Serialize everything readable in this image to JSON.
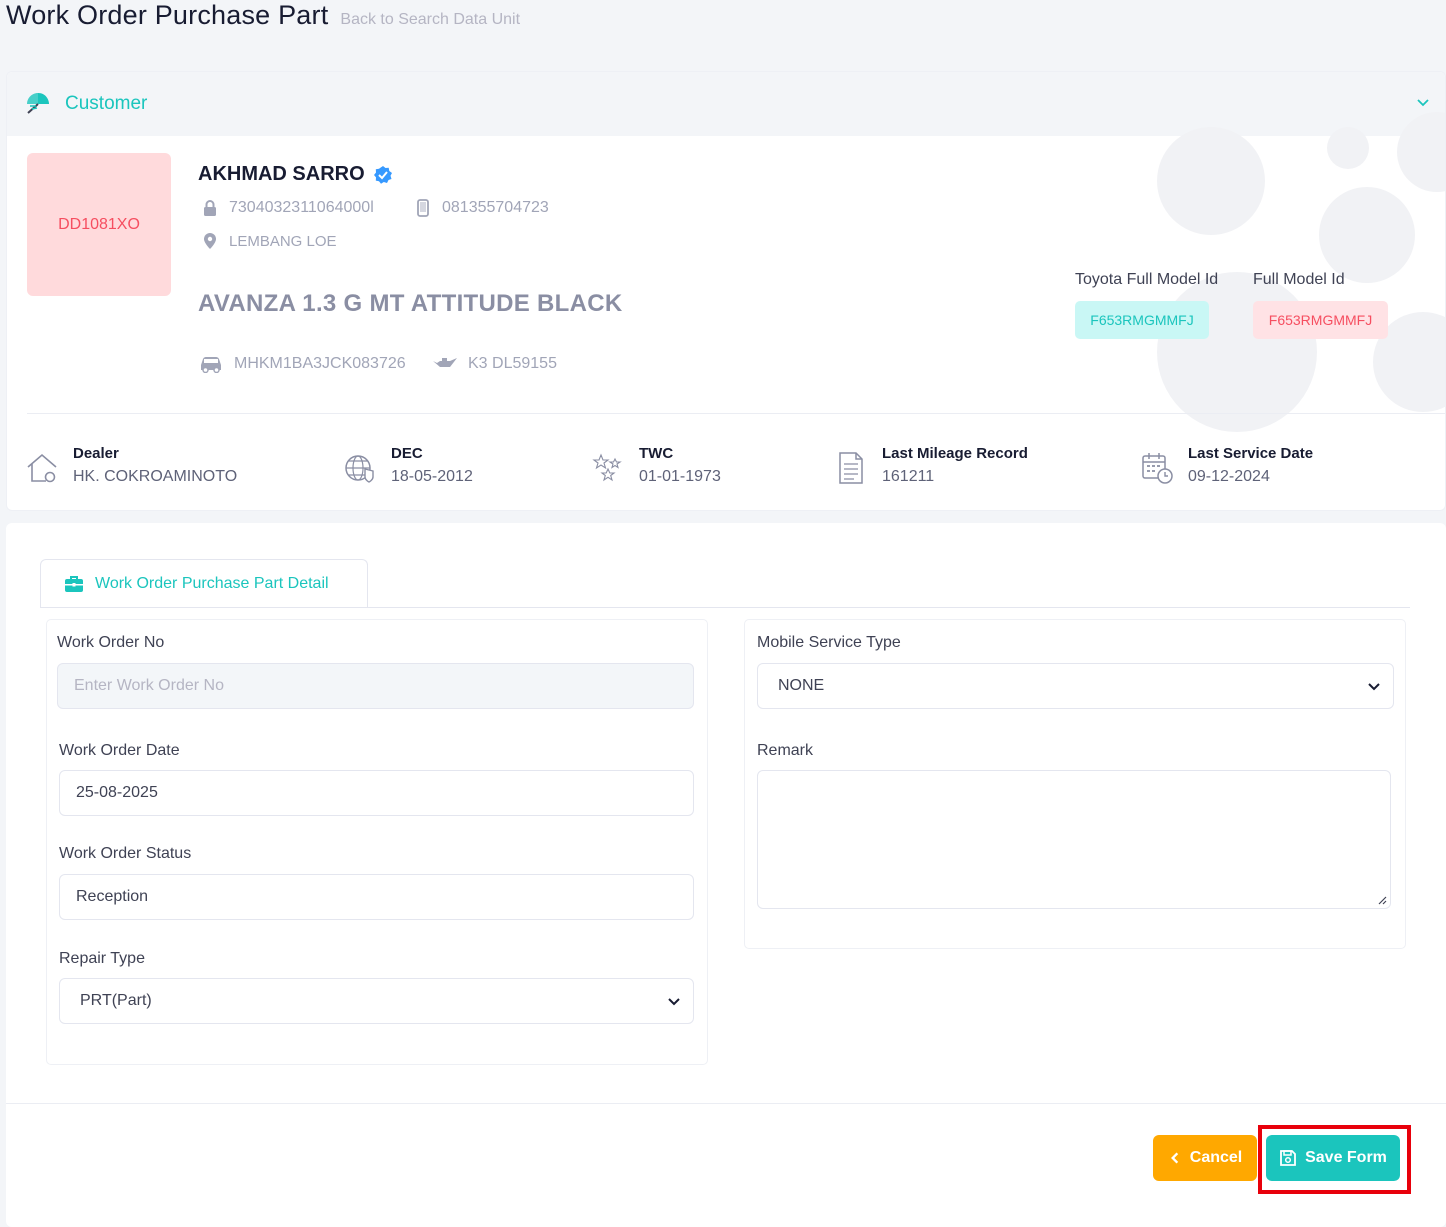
{
  "header": {
    "title": "Work Order Purchase Part",
    "back_link": "Back to Search Data Unit"
  },
  "customer": {
    "section_title": "Customer",
    "plate": "DD1081XO",
    "name": "AKHMAD SARRO",
    "id_number": "7304032311064000l",
    "phone": "081355704723",
    "location": "LEMBANG LOE",
    "model": "AVANZA 1.3 G MT ATTITUDE BLACK",
    "vin": "MHKM1BA3JCK083726",
    "engine": "K3 DL59155",
    "toyota_full_model_label": "Toyota Full Model Id",
    "toyota_full_model_value": "F653RMGMMFJ",
    "full_model_label": "Full Model Id",
    "full_model_value": "F653RMGMMFJ",
    "stats": [
      {
        "label": "Dealer",
        "value": "HK. COKROAMINOTO"
      },
      {
        "label": "DEC",
        "value": "18-05-2012"
      },
      {
        "label": "TWC",
        "value": "01-01-1973"
      },
      {
        "label": "Last Mileage Record",
        "value": "161211"
      },
      {
        "label": "Last Service Date",
        "value": "09-12-2024"
      }
    ]
  },
  "form": {
    "tab_label": "Work Order Purchase Part Detail",
    "work_order_no": {
      "label": "Work Order No",
      "placeholder": "Enter Work Order No"
    },
    "work_order_date": {
      "label": "Work Order Date",
      "value": "25-08-2025"
    },
    "work_order_status": {
      "label": "Work Order Status",
      "value": "Reception"
    },
    "repair_type": {
      "label": "Repair Type",
      "value": "PRT(Part)"
    },
    "mobile_service_type": {
      "label": "Mobile Service Type",
      "value": "NONE"
    },
    "remark": {
      "label": "Remark"
    }
  },
  "actions": {
    "cancel": "Cancel",
    "save": "Save Form"
  },
  "colors": {
    "accent": "#1bc5bd",
    "warning": "#ffa800",
    "danger": "#f64e60",
    "highlight": "#e8000b"
  }
}
